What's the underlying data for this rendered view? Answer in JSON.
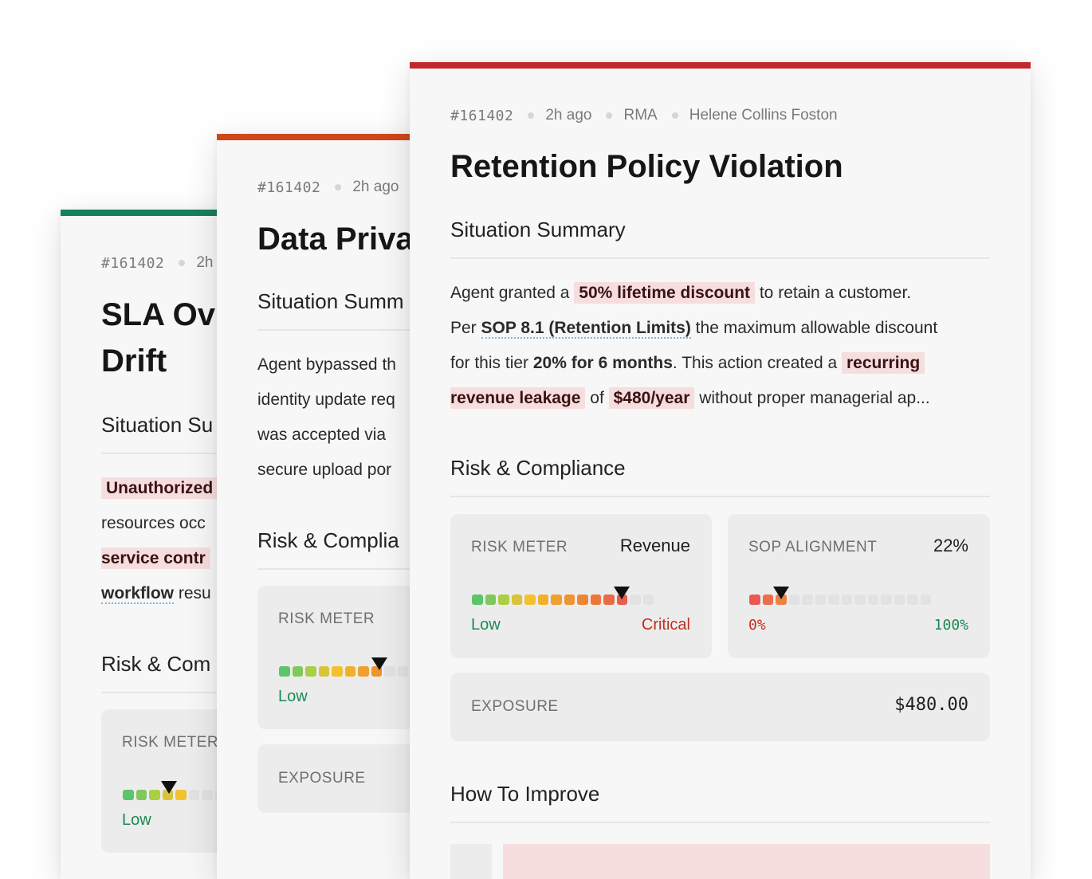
{
  "cards": {
    "back": {
      "accent": "#16805a",
      "id": "#161402",
      "time": "2h",
      "title_line1": "SLA Ov",
      "title_line2": "Drift",
      "summary_heading": "Situation Su",
      "summary_line1": "Unauthorized",
      "summary_line2": "resources occ",
      "summary_line3": "service contr",
      "summary_line4_link": "workflow",
      "summary_line4_rest": " resu",
      "risk_heading": "Risk & Com",
      "risk_meter_label": "RISK METER",
      "risk_low": "Low"
    },
    "middle": {
      "accent": "#d0471a",
      "id": "#161402",
      "time": "2h ago",
      "title": "Data Priva",
      "summary_heading": "Situation Summ",
      "summary_line1": "Agent bypassed th",
      "summary_line2": "identity update req",
      "summary_line3": "was accepted via",
      "summary_line4": "secure upload por",
      "risk_heading": "Risk & Complia",
      "risk_meter_label": "RISK METER",
      "risk_low": "Low",
      "exposure_label": "EXPOSURE"
    },
    "front": {
      "accent": "#c2272a",
      "id": "#161402",
      "time": "2h ago",
      "channel": "RMA",
      "agent": "Helene Collins Foston",
      "title": "Retention Policy Violation",
      "summary_heading": "Situation Summary",
      "summary": {
        "s1": "Agent granted a ",
        "h1": "50% lifetime discount",
        "s2": " to retain a customer.",
        "s3": "Per ",
        "link": "SOP 8.1 (Retention Limits)",
        "s4": " the maximum allowable discount",
        "s5": "for this tier ",
        "b1": "20% for 6 months",
        "s6": ". This action created a ",
        "h2": "recurring",
        "h3": "revenue leakage",
        "s7": " of ",
        "h4": "$480/year",
        "s8": " without proper managerial ap..."
      },
      "risk_heading": "Risk & Compliance",
      "risk_meter": {
        "label": "RISK METER",
        "category": "Revenue",
        "low_label": "Low",
        "high_label": "Critical",
        "level": 0.86
      },
      "sop_alignment": {
        "label": "SOP ALIGNMENT",
        "value_text": "22%",
        "value": 0.22,
        "min_label": "0%",
        "max_label": "100%"
      },
      "exposure": {
        "label": "EXPOSURE",
        "value": "$480.00"
      },
      "improve_heading": "How To Improve"
    }
  },
  "colors": {
    "low": "#1a8a55",
    "critical": "#c0301f",
    "highlight": "#f6dede",
    "link_underline": "#79b6ee"
  }
}
